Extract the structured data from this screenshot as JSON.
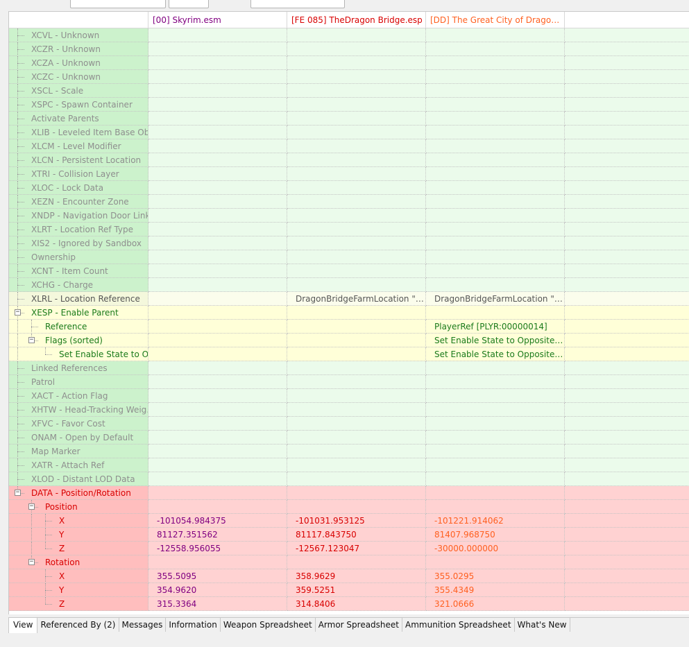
{
  "header": {
    "columns": [
      {
        "label": "",
        "color": "#333333"
      },
      {
        "label": "[00] Skyrim.esm",
        "color": "#800080"
      },
      {
        "label": "[FE 085] TheDragon Bridge.esp",
        "color": "#d80000"
      },
      {
        "label": "[DD] The Great City of Dragon Bri...",
        "color": "#ff6020"
      }
    ]
  },
  "rows": [
    {
      "style": "g",
      "depth": 1,
      "label": "XCVL - Unknown",
      "values": [
        "",
        "",
        ""
      ]
    },
    {
      "style": "g",
      "depth": 1,
      "label": "XCZR - Unknown",
      "values": [
        "",
        "",
        ""
      ]
    },
    {
      "style": "g",
      "depth": 1,
      "label": "XCZA - Unknown",
      "values": [
        "",
        "",
        ""
      ]
    },
    {
      "style": "g",
      "depth": 1,
      "label": "XCZC - Unknown",
      "values": [
        "",
        "",
        ""
      ]
    },
    {
      "style": "g",
      "depth": 1,
      "label": "XSCL - Scale",
      "values": [
        "",
        "",
        ""
      ]
    },
    {
      "style": "g",
      "depth": 1,
      "label": "XSPC - Spawn Container",
      "values": [
        "",
        "",
        ""
      ]
    },
    {
      "style": "g",
      "depth": 1,
      "label": "Activate Parents",
      "values": [
        "",
        "",
        ""
      ]
    },
    {
      "style": "g",
      "depth": 1,
      "label": "XLIB - Leveled Item Base Obj...",
      "values": [
        "",
        "",
        ""
      ]
    },
    {
      "style": "g",
      "depth": 1,
      "label": "XLCM - Level Modifier",
      "values": [
        "",
        "",
        ""
      ]
    },
    {
      "style": "g",
      "depth": 1,
      "label": "XLCN - Persistent Location",
      "values": [
        "",
        "",
        ""
      ]
    },
    {
      "style": "g",
      "depth": 1,
      "label": "XTRI - Collision Layer",
      "values": [
        "",
        "",
        ""
      ]
    },
    {
      "style": "g",
      "depth": 1,
      "label": "XLOC - Lock Data",
      "values": [
        "",
        "",
        ""
      ]
    },
    {
      "style": "g",
      "depth": 1,
      "label": "XEZN - Encounter Zone",
      "values": [
        "",
        "",
        ""
      ]
    },
    {
      "style": "g",
      "depth": 1,
      "label": "XNDP - Navigation Door Link",
      "values": [
        "",
        "",
        ""
      ]
    },
    {
      "style": "g",
      "depth": 1,
      "label": "XLRT - Location Ref Type",
      "values": [
        "",
        "",
        ""
      ]
    },
    {
      "style": "g",
      "depth": 1,
      "label": "XIS2 - Ignored by Sandbox",
      "values": [
        "",
        "",
        ""
      ]
    },
    {
      "style": "g",
      "depth": 1,
      "label": "Ownership",
      "values": [
        "",
        "",
        ""
      ]
    },
    {
      "style": "g",
      "depth": 1,
      "label": "XCNT - Item Count",
      "values": [
        "",
        "",
        ""
      ]
    },
    {
      "style": "g",
      "depth": 1,
      "label": "XCHG - Charge",
      "values": [
        "",
        "",
        ""
      ]
    },
    {
      "style": "yg",
      "depth": 1,
      "label": "XLRL - Location Reference",
      "values": [
        "",
        "DragonBridgeFarmLocation \"Dra...",
        "DragonBridgeFarmLocation \"Dra..."
      ]
    },
    {
      "style": "y",
      "depth": 1,
      "label": "XESP - Enable Parent",
      "toggle": "minus",
      "values": [
        "",
        "",
        ""
      ]
    },
    {
      "style": "y",
      "depth": 2,
      "label": "Reference",
      "values": [
        "",
        "",
        "PlayerRef [PLYR:00000014]"
      ]
    },
    {
      "style": "y",
      "depth": 2,
      "label": "Flags (sorted)",
      "toggle": "minus",
      "values": [
        "",
        "",
        "Set Enable State to Opposite of P..."
      ]
    },
    {
      "style": "y",
      "depth": 3,
      "label": "Set Enable State to O...",
      "values": [
        "",
        "",
        "Set Enable State to Opposite of P..."
      ]
    },
    {
      "style": "g",
      "depth": 1,
      "label": "Linked References",
      "values": [
        "",
        "",
        ""
      ]
    },
    {
      "style": "g",
      "depth": 1,
      "label": "Patrol",
      "values": [
        "",
        "",
        ""
      ]
    },
    {
      "style": "g",
      "depth": 1,
      "label": "XACT - Action Flag",
      "values": [
        "",
        "",
        ""
      ]
    },
    {
      "style": "g",
      "depth": 1,
      "label": "XHTW - Head-Tracking Weig...",
      "values": [
        "",
        "",
        ""
      ]
    },
    {
      "style": "g",
      "depth": 1,
      "label": "XFVC - Favor Cost",
      "values": [
        "",
        "",
        ""
      ]
    },
    {
      "style": "g",
      "depth": 1,
      "label": "ONAM - Open by Default",
      "values": [
        "",
        "",
        ""
      ]
    },
    {
      "style": "g",
      "depth": 1,
      "label": "Map Marker",
      "values": [
        "",
        "",
        ""
      ]
    },
    {
      "style": "g",
      "depth": 1,
      "label": "XATR - Attach Ref",
      "values": [
        "",
        "",
        ""
      ]
    },
    {
      "style": "g",
      "depth": 1,
      "label": "XLOD - Distant LOD Data",
      "values": [
        "",
        "",
        ""
      ]
    },
    {
      "style": "r",
      "depth": 1,
      "label": "DATA - Position/Rotation",
      "toggle": "minus",
      "values": [
        "",
        "",
        ""
      ]
    },
    {
      "style": "r",
      "depth": 2,
      "label": "Position",
      "toggle": "minus",
      "values": [
        "",
        "",
        ""
      ]
    },
    {
      "style": "r",
      "depth": 3,
      "label": "X",
      "values": [
        "-101054.984375",
        "-101031.953125",
        "-101221.914062"
      ]
    },
    {
      "style": "r",
      "depth": 3,
      "label": "Y",
      "values": [
        "81127.351562",
        "81117.843750",
        "81407.968750"
      ]
    },
    {
      "style": "r",
      "depth": 3,
      "label": "Z",
      "values": [
        "-12558.956055",
        "-12567.123047",
        "-30000.000000"
      ]
    },
    {
      "style": "r",
      "depth": 2,
      "label": "Rotation",
      "toggle": "minus",
      "values": [
        "",
        "",
        ""
      ]
    },
    {
      "style": "r",
      "depth": 3,
      "label": "X",
      "values": [
        "355.5095",
        "358.9629",
        "355.0295"
      ]
    },
    {
      "style": "r",
      "depth": 3,
      "label": "Y",
      "values": [
        "354.9620",
        "359.5251",
        "355.4349"
      ]
    },
    {
      "style": "r",
      "depth": 3,
      "label": "Z",
      "values": [
        "315.3364",
        "314.8406",
        "321.0666"
      ]
    }
  ],
  "tabs": [
    {
      "label": "View",
      "active": true
    },
    {
      "label": "Referenced By (2)",
      "active": false
    },
    {
      "label": "Messages",
      "active": false
    },
    {
      "label": "Information",
      "active": false
    },
    {
      "label": "Weapon Spreadsheet",
      "active": false
    },
    {
      "label": "Armor Spreadsheet",
      "active": false
    },
    {
      "label": "Ammunition Spreadsheet",
      "active": false
    },
    {
      "label": "What's New",
      "active": false
    }
  ]
}
